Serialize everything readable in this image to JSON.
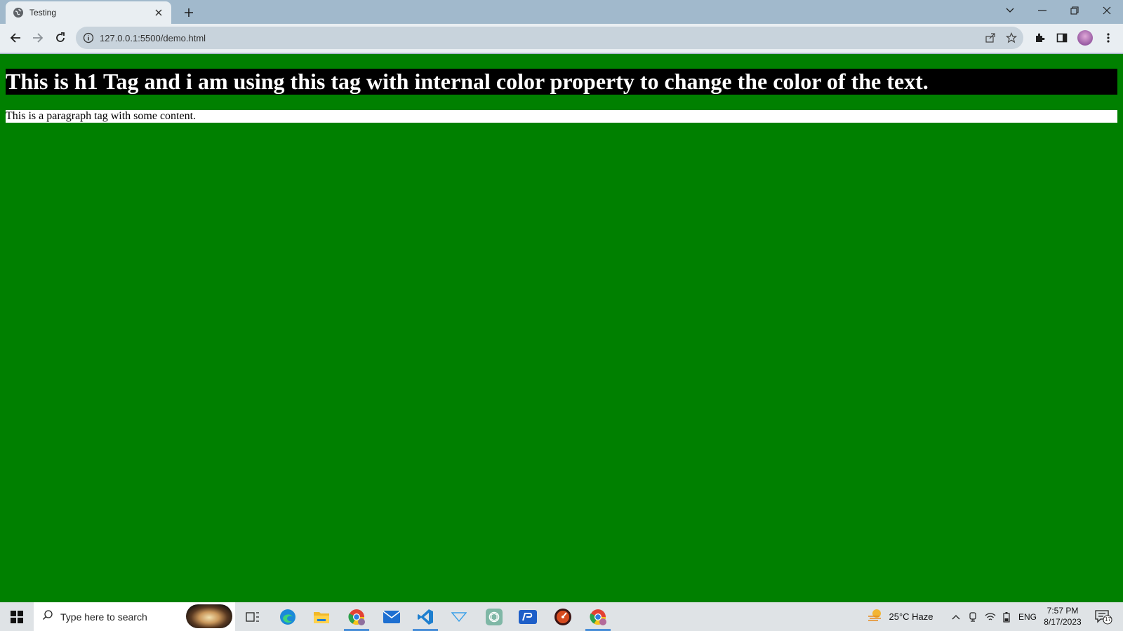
{
  "browser": {
    "tab_title": "Testing",
    "url": "127.0.0.1:5500/demo.html"
  },
  "page": {
    "h1_text": "This is h1 Tag and i am using this tag with internal color property to change the color of the text.",
    "p_text": "This is a paragraph tag with some content.",
    "body_bg_color": "#008000",
    "h1_bg_color": "#000000",
    "h1_text_color": "#ffffff",
    "p_bg_color": "#ffffff"
  },
  "taskbar": {
    "search_placeholder": "Type here to search",
    "weather": "25°C  Haze",
    "language": "ENG",
    "time": "7:57 PM",
    "date": "8/17/2023",
    "notification_count": "17",
    "apps": [
      "task-view",
      "edge",
      "file-explorer",
      "chrome-profile",
      "mail",
      "vs-code",
      "filter",
      "chatgpt",
      "app-blue",
      "media-app",
      "chrome"
    ]
  }
}
